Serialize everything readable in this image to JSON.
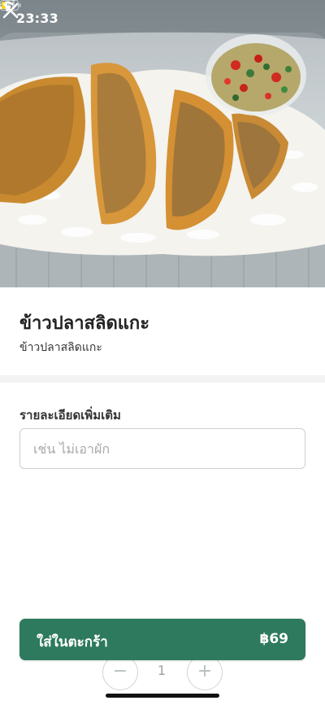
{
  "status_bar": {
    "time": "23:33",
    "location_icon": "location-arrow-icon",
    "signal_icon": "cellular-signal-icon",
    "wifi_icon": "wifi-icon",
    "battery_icon": "battery-icon",
    "battery_level": 0.25,
    "battery_color": "#ffd60a"
  },
  "hero": {
    "image_icon": "food-photo",
    "close_icon": "close-icon"
  },
  "item": {
    "title": "ข้าวปลาสลิดแกะ",
    "subtitle": "ข้าวปลาสลิดแกะ"
  },
  "notes": {
    "label": "รายละเอียดเพิ่มเติม",
    "placeholder": "เช่น ไม่เอาผัก",
    "value": ""
  },
  "quantity": {
    "minus": "−",
    "value": "1",
    "plus": "+"
  },
  "cart_button": {
    "label": "ใส่ในตะกร้า",
    "price": "฿69",
    "color": "#2e7a5e"
  }
}
